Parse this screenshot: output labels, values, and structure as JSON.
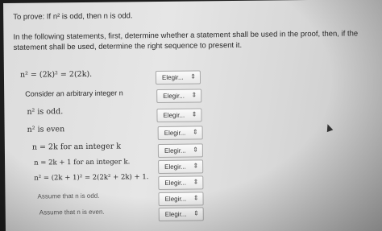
{
  "prompt": "To prove: If n² is odd, then n is odd.",
  "instructions": "In the following statements, first, determine whether a statement shall be used in the proof, then, if the statement shall be used, determine the right sequence to present it.",
  "statements": [
    {
      "text": "n² = (2k)² = 2(2k).",
      "select": "Elegir..."
    },
    {
      "text": "Consider an arbitrary integer n",
      "select": "Elegir..."
    },
    {
      "text": "n² is odd.",
      "select": "Elegir..."
    },
    {
      "text": "n² is even",
      "select": "Elegir..."
    },
    {
      "text": "n = 2k for an integer k",
      "select": "Elegir..."
    },
    {
      "text": "n = 2k + 1 for an integer k.",
      "select": "Elegir..."
    },
    {
      "text": "n² = (2k + 1)² = 2(2k² + 2k) + 1.",
      "select": "Elegir..."
    },
    {
      "text": "Assume that n is odd.",
      "select": "Elegir..."
    },
    {
      "text": "Assume that n is even.",
      "select": "Elegir..."
    }
  ],
  "icons": {
    "dropdown": "up-down-chevron-icon",
    "cursor": "mouse-pointer-icon"
  },
  "colors": {
    "page": "#e2e2e2",
    "select_bg": "#f4f4f4",
    "border": "#a8a8a8"
  }
}
